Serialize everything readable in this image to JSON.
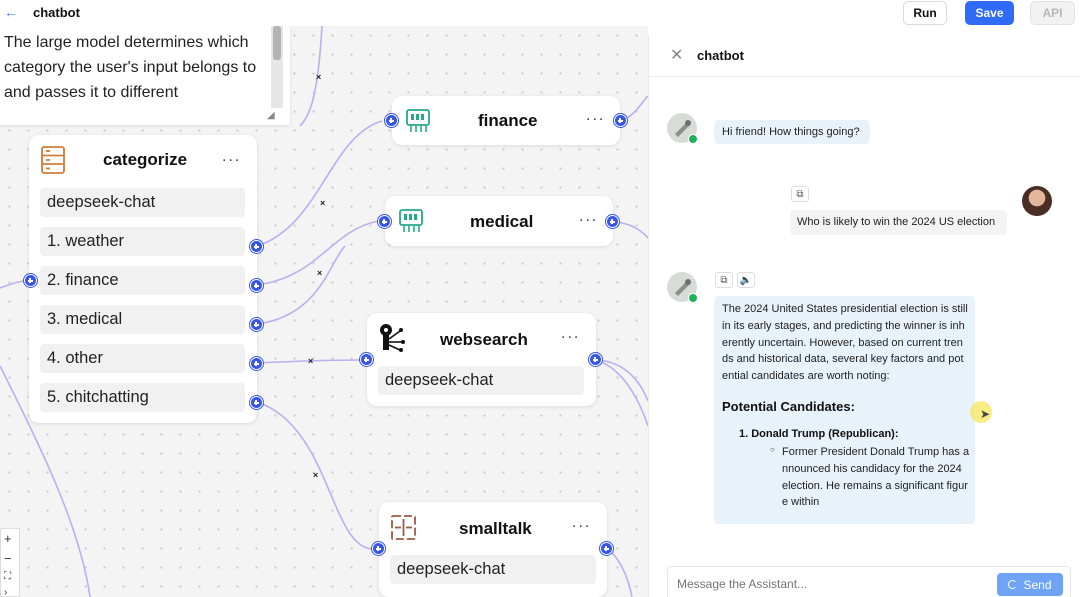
{
  "topbar": {
    "title": "chatbot",
    "run_label": "Run",
    "save_label": "Save",
    "api_label": "API"
  },
  "canvas": {
    "text_node": {
      "text": "The large model determines which category the user's input belongs to and passes it to different"
    },
    "categorize_node": {
      "title": "categorize",
      "model": "deepseek-chat",
      "items": [
        "1. weather",
        "2. finance",
        "3. medical",
        "4. other",
        "5. chitchatting"
      ]
    },
    "finance_node": {
      "title": "finance"
    },
    "medical_node": {
      "title": "medical"
    },
    "websearch_node": {
      "title": "websearch",
      "model": "deepseek-chat"
    },
    "smalltalk_node": {
      "title": "smalltalk",
      "model": "deepseek-chat"
    },
    "more_label": "...",
    "edge_delete_label": "×",
    "zoom": {
      "in": "+",
      "out": "−",
      "fit": "⛶",
      "more": "›"
    }
  },
  "chat": {
    "title": "chatbot",
    "messages": {
      "greeting": "Hi friend! How things going?",
      "user_question": "Who is likely to win the 2024 US election",
      "answer_intro": "The 2024 United States presidential election is still in its early stages, and predicting the winner is inherently uncertain. However, based on current trends and historical data, several key factors and potential candidates are worth noting:",
      "answer_heading": "Potential Candidates:",
      "answer_item": "1. Donald Trump (Republican):",
      "answer_subitem": "Former President Donald Trump has announced his candidacy for the 2024 election. He remains a significant figure within"
    },
    "composer": {
      "placeholder": "Message the Assistant...",
      "send_label": "Send"
    }
  },
  "colors": {
    "primary": "#2f6bf6",
    "port": "#3556e8",
    "edge": "#b3a8f0",
    "bot_bubble": "#e8f2fb",
    "online": "#20b25a"
  }
}
